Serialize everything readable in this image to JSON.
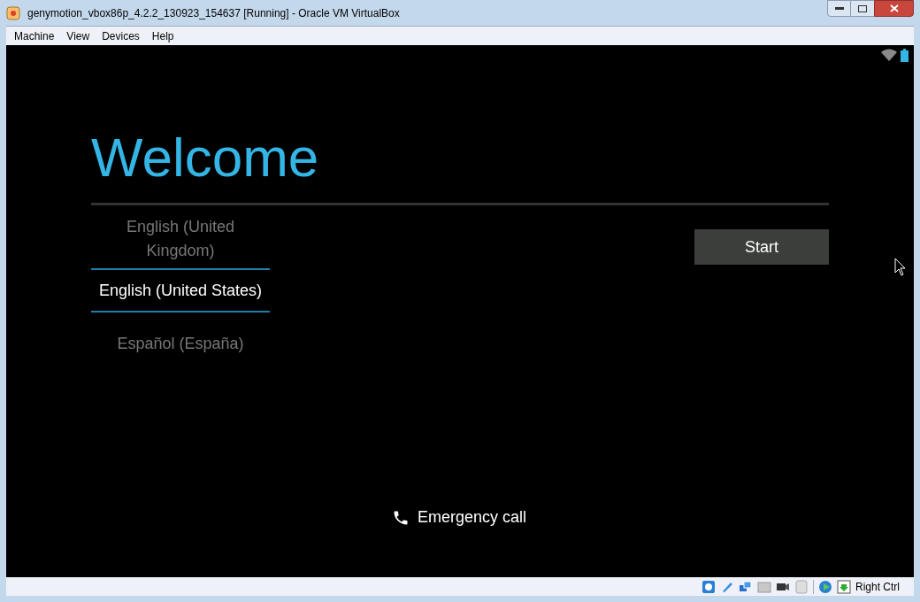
{
  "window": {
    "title": "genymotion_vbox86p_4.2.2_130923_154637 [Running] - Oracle VM VirtualBox"
  },
  "menu": [
    "Machine",
    "View",
    "Devices",
    "Help"
  ],
  "screen": {
    "heading": "Welcome",
    "languages": [
      {
        "label": "English (United Kingdom)",
        "selected": false
      },
      {
        "label": "English (United States)",
        "selected": true
      },
      {
        "label": "Español (España)",
        "selected": false
      }
    ],
    "start_button": "Start",
    "emergency": "Emergency call"
  },
  "status_bar": {
    "host_key": "Right Ctrl"
  }
}
